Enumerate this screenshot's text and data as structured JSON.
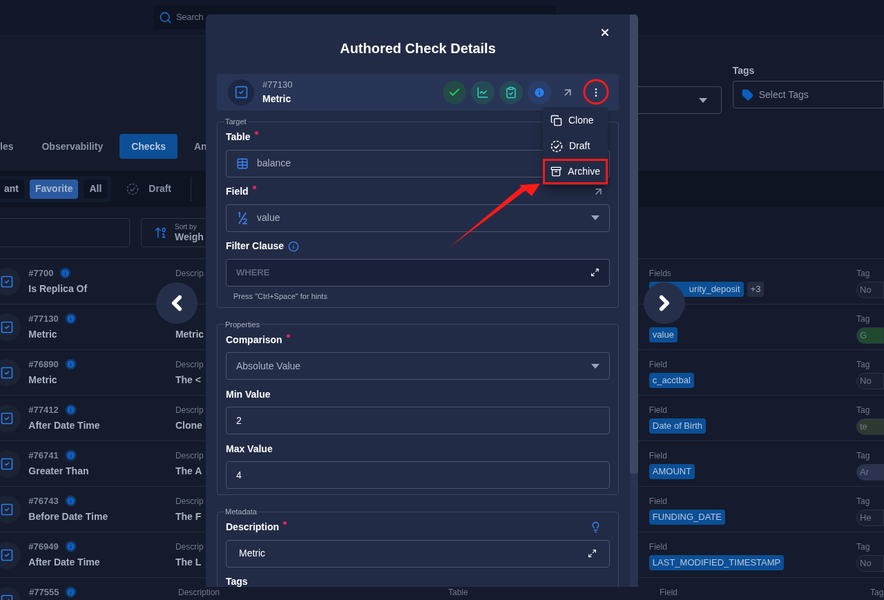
{
  "top_search": {
    "placeholder": "Search"
  },
  "filter_select": {
    "label": "Tags",
    "placeholder": "Select Tags"
  },
  "tabs": [
    {
      "label": "les",
      "selected": false
    },
    {
      "label": "Observability",
      "selected": false
    },
    {
      "label": "Checks",
      "selected": true
    },
    {
      "label": "An",
      "selected": false
    }
  ],
  "filters": [
    {
      "label": "ant",
      "selected": false
    },
    {
      "label": "Favorite",
      "selected": true
    },
    {
      "label": "All",
      "selected": false
    }
  ],
  "draft_filter": "Draft",
  "sort": {
    "caption": "Sort by",
    "value": "Weigh"
  },
  "checks": [
    {
      "id": "#7700",
      "name": "Is Replica Of",
      "description_label": "Descrip",
      "field_label": "Fields",
      "covered_field": "urity_deposit",
      "extra": "+3",
      "tag_label": "Tag",
      "tag": {
        "text": "No",
        "color": "#1a2030"
      }
    },
    {
      "id": "#77130",
      "name": "Metric",
      "description": "Metric",
      "fields": [
        "value"
      ],
      "tag_label": "Tag",
      "tag": {
        "text": "G",
        "color": "#1f4a2e"
      }
    },
    {
      "id": "#76890",
      "name": "Metric",
      "description_label": "Descrip",
      "description": "The <",
      "field_label": "Field",
      "fields": [
        "c_acctbal"
      ],
      "tag_label": "Tag",
      "tag": {
        "text": "No",
        "color": "#1a2030"
      }
    },
    {
      "id": "#77412",
      "name": "After Date Time",
      "description_label": "Descrip",
      "description": "Clone",
      "field_label": "Field",
      "fields": [
        "Date of Birth"
      ],
      "tag_label": "Tag",
      "tag": {
        "text": "te",
        "color": "#2e3a30"
      }
    },
    {
      "id": "#76741",
      "name": "Greater Than",
      "description_label": "Descrip",
      "description": "The A",
      "field_label": "Field",
      "fields": [
        "AMOUNT"
      ],
      "tag_label": "Tag",
      "tag": {
        "text": "Ar",
        "color": "#2c3350"
      }
    },
    {
      "id": "#76743",
      "name": "Before Date Time",
      "description_label": "Descrip",
      "description": "The F",
      "field_label": "Field",
      "fields": [
        "FUNDING_DATE"
      ],
      "tag_label": "Tag",
      "tag": {
        "text": "He",
        "color": "#1a2030"
      }
    },
    {
      "id": "#76949",
      "name": "After Date Time",
      "description_label": "Descrip",
      "description": "The L",
      "field_label": "Field",
      "fields": [
        "LAST_MODIFIED_TIMESTAMP"
      ],
      "tag_label": "Tag",
      "tag": {
        "text": "No",
        "color": "#1a2030"
      }
    },
    {
      "id": "#77555",
      "description_label": "Description",
      "table_label": "Table",
      "field_label": "Field",
      "tag_label": "Tag"
    }
  ],
  "modal": {
    "title": "Authored Check Details",
    "check": {
      "id": "#77130",
      "name": "Metric"
    },
    "menu": [
      {
        "label": "Clone",
        "kind": "clone",
        "highlighted": false
      },
      {
        "label": "Draft",
        "kind": "draft",
        "highlighted": false
      },
      {
        "label": "Archive",
        "kind": "archive",
        "highlighted": true
      }
    ],
    "sections": [
      {
        "legend": "Target",
        "fields": [
          {
            "kind": "table-select",
            "label": "Table",
            "required": true,
            "value": "balance"
          },
          {
            "kind": "field-select",
            "label": "Field",
            "required": true,
            "value": "value"
          },
          {
            "kind": "code-input",
            "label": "Filter Clause",
            "required": false,
            "placeholder": "WHERE",
            "hint": "Press \"Ctrl+Space\" for hints"
          }
        ]
      },
      {
        "legend": "Properties",
        "fields": [
          {
            "kind": "select",
            "label": "Comparison",
            "required": true,
            "value": "Absolute Value"
          },
          {
            "kind": "input",
            "label": "Min Value",
            "required": false,
            "value": "2"
          },
          {
            "kind": "input",
            "label": "Max Value",
            "required": false,
            "value": "4"
          }
        ]
      },
      {
        "legend": "Metadata",
        "fields": [
          {
            "kind": "text-expand",
            "label": "Description",
            "required": true,
            "value": "Metric"
          },
          {
            "kind": "label-only",
            "label": "Tags",
            "required": false
          }
        ]
      }
    ]
  }
}
